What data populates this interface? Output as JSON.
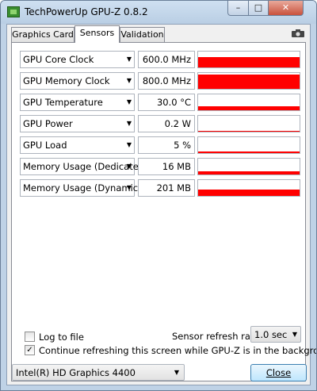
{
  "window": {
    "title": "TechPowerUp GPU-Z 0.8.2",
    "minimize_glyph": "–",
    "maximize_glyph": "□",
    "close_glyph": "✕"
  },
  "tabs": [
    {
      "label": "Graphics Card",
      "active": false
    },
    {
      "label": "Sensors",
      "active": true
    },
    {
      "label": "Validation",
      "active": false
    }
  ],
  "sensors": [
    {
      "label": "GPU Core Clock",
      "value": "600.0 MHz",
      "level": 0.7
    },
    {
      "label": "GPU Memory Clock",
      "value": "800.0 MHz",
      "level": 1.0
    },
    {
      "label": "GPU Temperature",
      "value": "30.0 °C",
      "level": 0.3
    },
    {
      "label": "GPU Power",
      "value": "0.2 W",
      "level": 0.05
    },
    {
      "label": "GPU Load",
      "value": "5 %",
      "level": 0.1
    },
    {
      "label": "Memory Usage (Dedicated)",
      "value": "16 MB",
      "level": 0.2
    },
    {
      "label": "Memory Usage (Dynamic)",
      "value": "201 MB",
      "level": 0.45
    }
  ],
  "dropdown_glyph": "▼",
  "graph_color": "#ff0000",
  "options": {
    "log_to_file": {
      "label": "Log to file",
      "checked": false
    },
    "continue_refreshing": {
      "label": "Continue refreshing this screen while GPU-Z is in the background",
      "checked": true
    },
    "check_glyph": "✓"
  },
  "refresh": {
    "label": "Sensor refresh rate:",
    "value": "1.0 sec"
  },
  "device": {
    "selected": "Intel(R) HD Graphics 4400"
  },
  "close_button": {
    "label": "Close"
  }
}
